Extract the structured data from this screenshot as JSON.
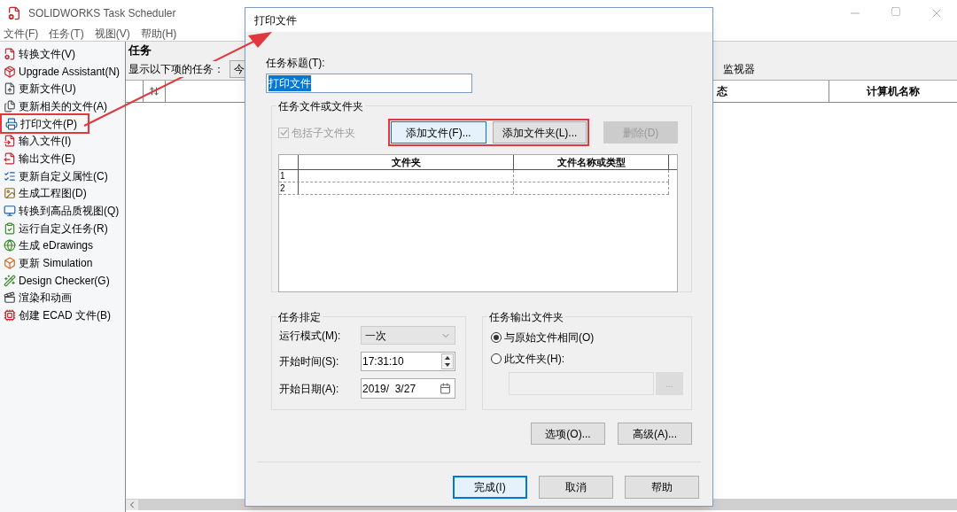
{
  "app": {
    "title": "SOLIDWORKS Task Scheduler",
    "menu": [
      "文件(F)",
      "任务(T)",
      "视图(V)",
      "帮助(H)"
    ]
  },
  "sidebar": {
    "items": [
      {
        "label": "转换文件(V)",
        "highlighted": false
      },
      {
        "label": "Upgrade Assistant(N)",
        "highlighted": false
      },
      {
        "label": "更新文件(U)",
        "highlighted": false
      },
      {
        "label": "更新相关的文件(A)",
        "highlighted": false
      },
      {
        "label": "打印文件(P)",
        "highlighted": true
      },
      {
        "label": "输入文件(I)",
        "highlighted": false
      },
      {
        "label": "输出文件(E)",
        "highlighted": false
      },
      {
        "label": "更新自定义属性(C)",
        "highlighted": false
      },
      {
        "label": "生成工程图(D)",
        "highlighted": false
      },
      {
        "label": "转换到高品质视图(Q)",
        "highlighted": false
      },
      {
        "label": "运行自定义任务(R)",
        "highlighted": false
      },
      {
        "label": "生成 eDrawings",
        "highlighted": false
      },
      {
        "label": "更新 Simulation",
        "highlighted": false
      },
      {
        "label": "Design Checker(G)",
        "highlighted": false
      },
      {
        "label": "渲染和动画",
        "highlighted": false
      },
      {
        "label": "创建 ECAD 文件(B)",
        "highlighted": false
      }
    ]
  },
  "tasks_panel": {
    "heading": "任务",
    "filter_label": "显示以下项的任务：",
    "filter_value": "今",
    "monitor_label": "监视器",
    "columns": [
      "态",
      "计算机名称"
    ]
  },
  "dialog": {
    "title": "打印文件",
    "task_title_label": "任务标题(T):",
    "task_title_value": "打印文件",
    "task_title_selected": true,
    "files_group": {
      "title": "任务文件或文件夹",
      "include_subfolders": {
        "label": "包括子文件夹",
        "checked": true,
        "disabled": true
      },
      "buttons": [
        {
          "label": "添加文件(F)...",
          "focused": true,
          "disabled": false,
          "framed": true
        },
        {
          "label": "添加文件夹(L)...",
          "focused": false,
          "disabled": false,
          "framed": true
        },
        {
          "label": "删除(D)",
          "focused": false,
          "disabled": true,
          "framed": false
        }
      ],
      "grid": {
        "columns": [
          "文件夹",
          "文件名称或类型"
        ],
        "rows": [
          "1",
          "2"
        ]
      }
    },
    "schedule_group": {
      "title": "任务排定",
      "run_mode_label": "运行模式(M):",
      "run_mode_value": "一次",
      "start_time_label": "开始时间(S):",
      "start_time_value": "17:31:10",
      "start_date_label": "开始日期(A):",
      "start_date_value": "2019/  3/27"
    },
    "output_group": {
      "title": "任务输出文件夹",
      "options": [
        {
          "label": "与原始文件相同(O)",
          "selected": true
        },
        {
          "label": "此文件夹(H):",
          "selected": false
        }
      ],
      "browse_button": "..."
    },
    "option_buttons": [
      "选项(O)...",
      "高级(A)..."
    ],
    "footer_buttons": [
      {
        "label": "完成(I)",
        "default": true
      },
      {
        "label": "取消",
        "default": false
      },
      {
        "label": "帮助",
        "default": false
      }
    ]
  }
}
